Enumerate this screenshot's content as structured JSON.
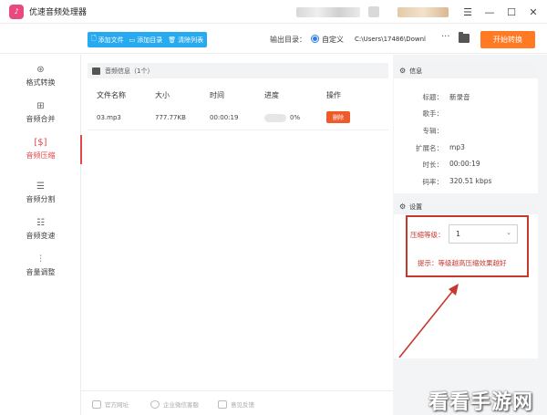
{
  "window": {
    "title": "优速音频处理器",
    "logo_glyph": "♪",
    "controls": [
      "☰",
      "—",
      "☐",
      "✕"
    ]
  },
  "toolbar": {
    "buttons": [
      {
        "icon": "file-add-icon",
        "glyph": "🗋",
        "label": "添加文件"
      },
      {
        "icon": "folder-add-icon",
        "glyph": "▭",
        "label": "添加目录"
      },
      {
        "icon": "trash-icon",
        "glyph": "🗑",
        "label": "清除列表"
      }
    ],
    "output_label": "输出目录：",
    "output_mode": "自定义",
    "output_path": "C:\\Users\\17486\\Downl",
    "more_label": "···",
    "start_label": "开始转换",
    "accent": "#27aaf0",
    "start_color": "#ff7a22"
  },
  "sidebar": {
    "items": [
      {
        "icon": "⊛",
        "label": "格式转换",
        "active": false
      },
      {
        "icon": "⊞",
        "label": "音频合并",
        "active": false
      },
      {
        "icon": "[$]",
        "label": "音频压缩",
        "active": true
      },
      {
        "icon": "☰",
        "label": "音频分割",
        "active": false
      },
      {
        "icon": "☷",
        "label": "音频变速",
        "active": false
      },
      {
        "icon": "⫶",
        "label": "音量调整",
        "active": false
      }
    ],
    "active_color": "#e2474b"
  },
  "file_panel": {
    "header": "音频信息（1个）",
    "columns": [
      "文件名称",
      "大小",
      "时间",
      "进度",
      "操作"
    ],
    "rows": [
      {
        "name": "03.mp3",
        "size": "777.77KB",
        "time": "00:00:19",
        "progress": 0,
        "progress_text": "0%",
        "action": "删除"
      }
    ]
  },
  "info_panel": {
    "header": "信息",
    "fields": [
      {
        "key": "标题：",
        "value": "新录音"
      },
      {
        "key": "歌手：",
        "value": ""
      },
      {
        "key": "专辑：",
        "value": ""
      },
      {
        "key": "扩展名：",
        "value": "mp3"
      },
      {
        "key": "时长：",
        "value": "00:00:19"
      },
      {
        "key": "码率：",
        "value": "320.51 kbps"
      }
    ]
  },
  "settings_panel": {
    "header": "设置",
    "level_label": "压缩等级：",
    "level_value": "1",
    "tip": "提示：等级越高压缩效果越好",
    "highlight_color": "#c6392f"
  },
  "bottom_bar": {
    "items": [
      "官方网址",
      "企业微信客服",
      "意见反馈"
    ]
  },
  "watermark": "看看手游网"
}
